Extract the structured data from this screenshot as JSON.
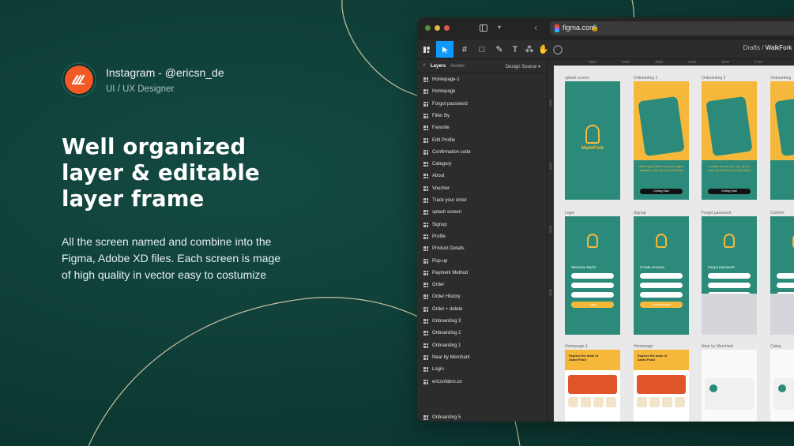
{
  "author": {
    "name": "Instagram - @ericsn_de",
    "role": "UI / UX Designer"
  },
  "headline": [
    "Well organized",
    "layer & editable",
    "layer frame"
  ],
  "description": [
    "All the screen named and combine into the",
    "Figma, Adobe XD files. Each screen is mage",
    "of high quality in vector easy to costumize"
  ],
  "browser": {
    "url": "figma.com"
  },
  "toolbar": {
    "crumb_parent": "Drafts",
    "crumb_sep": "/",
    "crumb_file": "WalkFork Mobile"
  },
  "layers_panel": {
    "tab_layers": "Layers",
    "tab_assets": "Assets",
    "source": "Design Source",
    "items": [
      "Homepage-1",
      "Homepage",
      "Forgot password",
      "Filter By",
      "Favorite",
      "Edit Profile",
      "Confirmation code",
      "Category",
      "About",
      "Voucher",
      "Track your order",
      "splash screen",
      "Signup",
      "Profile",
      "Product Details",
      "Pop-up",
      "Payment Method",
      "Order",
      "Order History",
      "Order + delete",
      "Onboarding 3",
      "Onboarding 2",
      "Onboarding 1",
      "Near by Merchant",
      "Login",
      "ericsnfabro.co"
    ],
    "last_item": "Onboarding 5"
  },
  "canvas": {
    "ruler_ticks": [
      "3550",
      "3750",
      "4000",
      "4250",
      "4500",
      "4750"
    ],
    "ruler_left": [
      "1000",
      "1500",
      "2000",
      "2500"
    ],
    "frames": [
      {
        "label": "splash screen",
        "style": "teal",
        "content": "MadeFork"
      },
      {
        "label": "Onboarding 1",
        "style": "yellow",
        "content": "After a good dinner one can forgive anybody, even one's own relatives"
      },
      {
        "label": "Onboarding 2",
        "style": "yellow",
        "content": "A recipe has no soul. You, as the cook, must bring soul to the recipe"
      },
      {
        "label": "Onboarding",
        "style": "yellow",
        "content": ""
      },
      {
        "label": "Login",
        "style": "teal",
        "content": "Welcome Back!"
      },
      {
        "label": "Signup",
        "style": "teal",
        "content": "Create Account"
      },
      {
        "label": "Forgot password",
        "style": "teal",
        "content": "Forgot password"
      },
      {
        "label": "Confirm",
        "style": "teal",
        "content": ""
      },
      {
        "label": "Homepage-1",
        "style": "mix",
        "content": "Explore the taste of Asian Food"
      },
      {
        "label": "Homepage",
        "style": "mix",
        "content": "Explore the taste of Asian Food"
      },
      {
        "label": "Near by Merchant",
        "style": "white",
        "content": ""
      },
      {
        "label": "Categ",
        "style": "white",
        "content": ""
      }
    ],
    "buttons": {
      "onboarding": "Getting Start",
      "login": "Login",
      "signup": "Create Account",
      "forgot": "Send"
    }
  },
  "colors": {
    "bg": "#0f3f38",
    "accent": "#f15a24",
    "figma_blue": "#0d99ff",
    "teal_screen": "#2b8a7a",
    "yellow_screen": "#f6b83a"
  }
}
